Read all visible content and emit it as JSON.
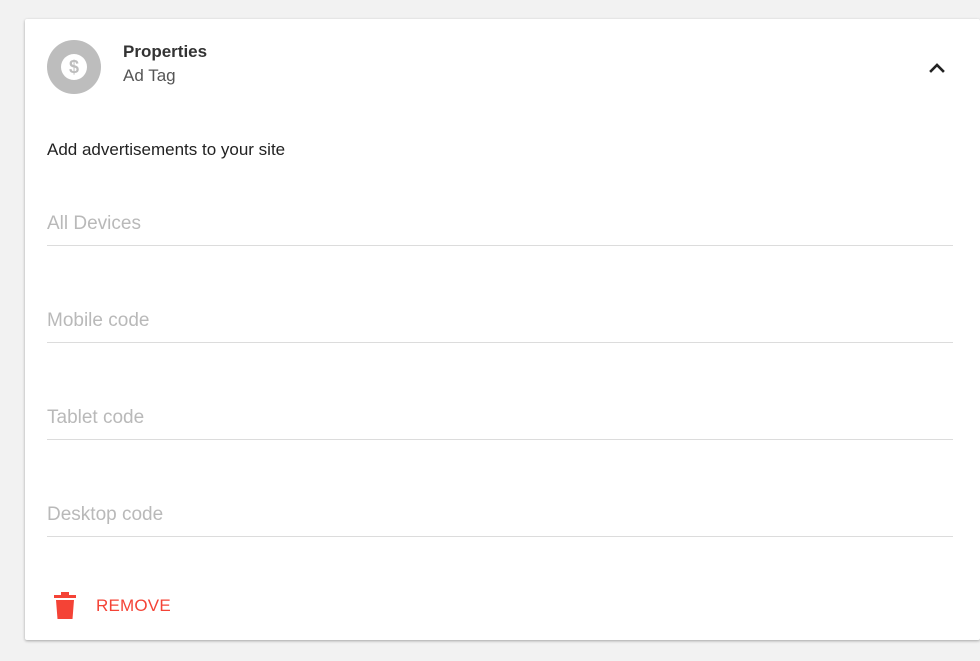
{
  "header": {
    "title": "Properties",
    "subtitle": "Ad Tag",
    "avatar_icon": "dollar-icon",
    "collapse_icon": "chevron-up-icon"
  },
  "description": "Add advertisements to your site",
  "fields": {
    "all_devices": {
      "placeholder": "All Devices",
      "value": ""
    },
    "mobile": {
      "placeholder": "Mobile code",
      "value": ""
    },
    "tablet": {
      "placeholder": "Tablet code",
      "value": ""
    },
    "desktop": {
      "placeholder": "Desktop code",
      "value": ""
    }
  },
  "remove": {
    "label": "REMOVE",
    "icon": "trash-icon"
  },
  "colors": {
    "avatar_bg": "#bdbdbd",
    "danger": "#f44336",
    "divider": "#dcdcdc",
    "placeholder": "#b9b9b9"
  }
}
